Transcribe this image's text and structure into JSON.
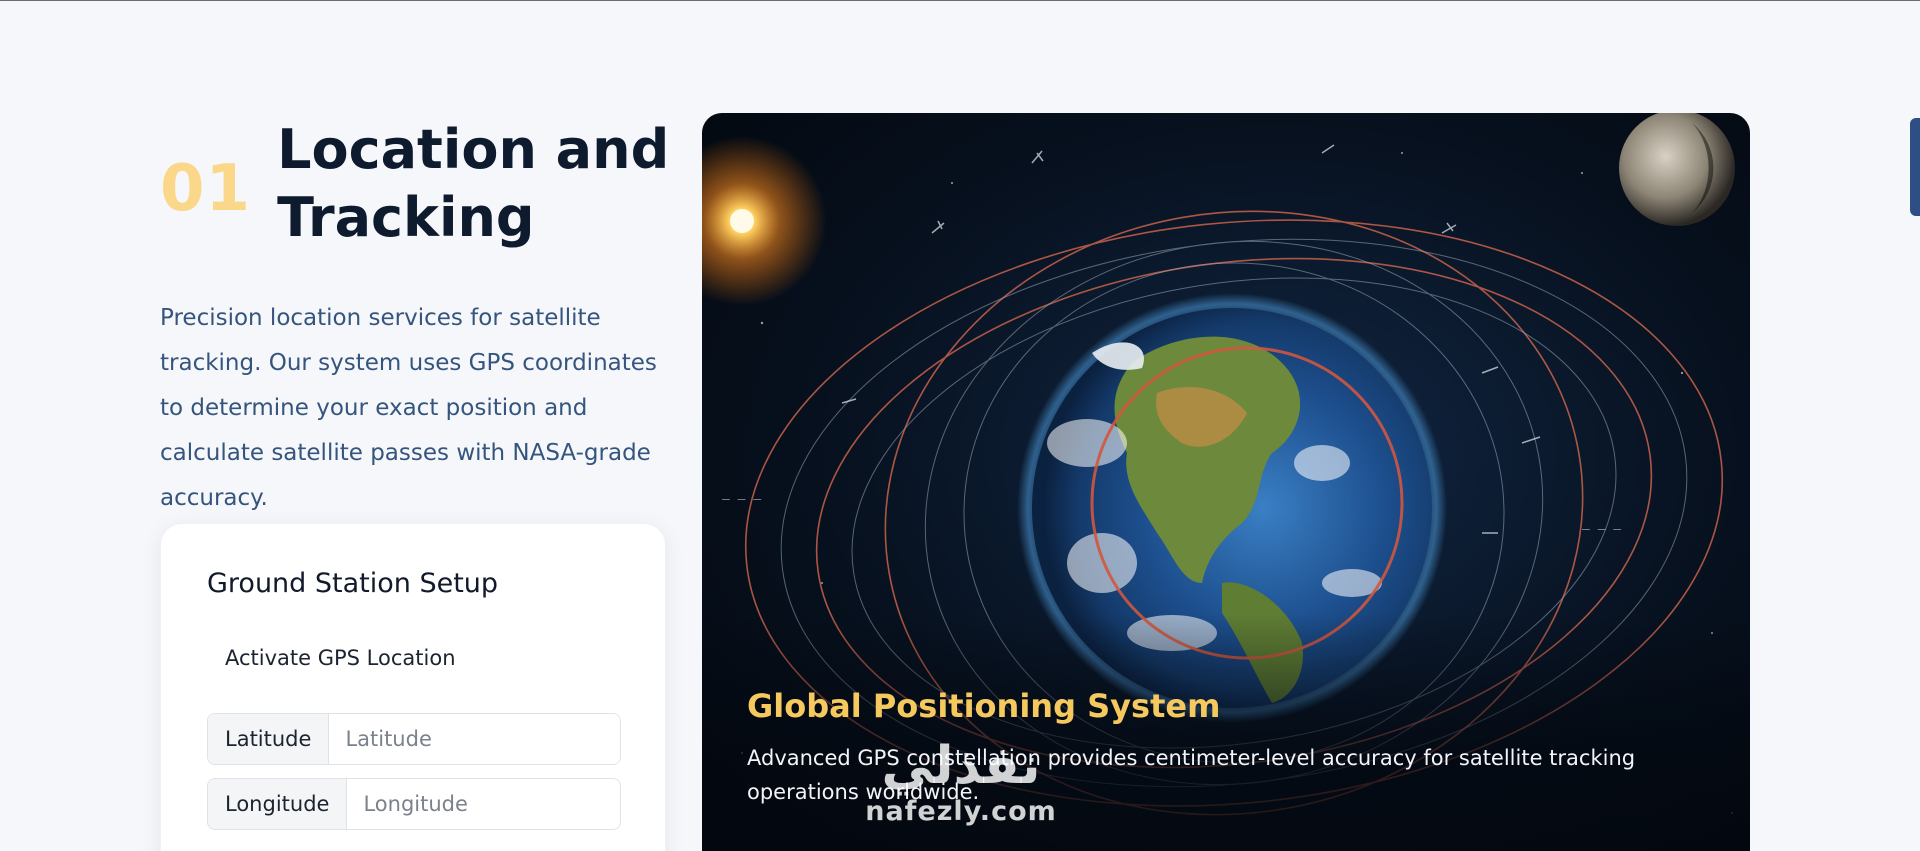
{
  "section": {
    "number": "01",
    "title": "Location and Tracking",
    "description": "Precision location services for satellite tracking. Our system uses GPS coordinates to determine your exact position and calculate satellite passes with NASA-grade accuracy."
  },
  "ground_station": {
    "title": "Ground Station Setup",
    "gps_button_label": "Activate GPS Location",
    "latitude_label": "Latitude",
    "latitude_placeholder": "Latitude",
    "longitude_label": "Longitude",
    "longitude_placeholder": "Longitude"
  },
  "hero": {
    "title": "Global Positioning System",
    "text": "Advanced GPS constellation provides centimeter-level accuracy for satellite tracking operations worldwide."
  },
  "watermark": {
    "arabic": "نفذلي",
    "latin": "nafezly.com"
  },
  "colors": {
    "accent_number": "#fbd78a",
    "hero_title": "#f6c95f",
    "description_text": "#35557e",
    "side_tab": "#2e4f86"
  }
}
